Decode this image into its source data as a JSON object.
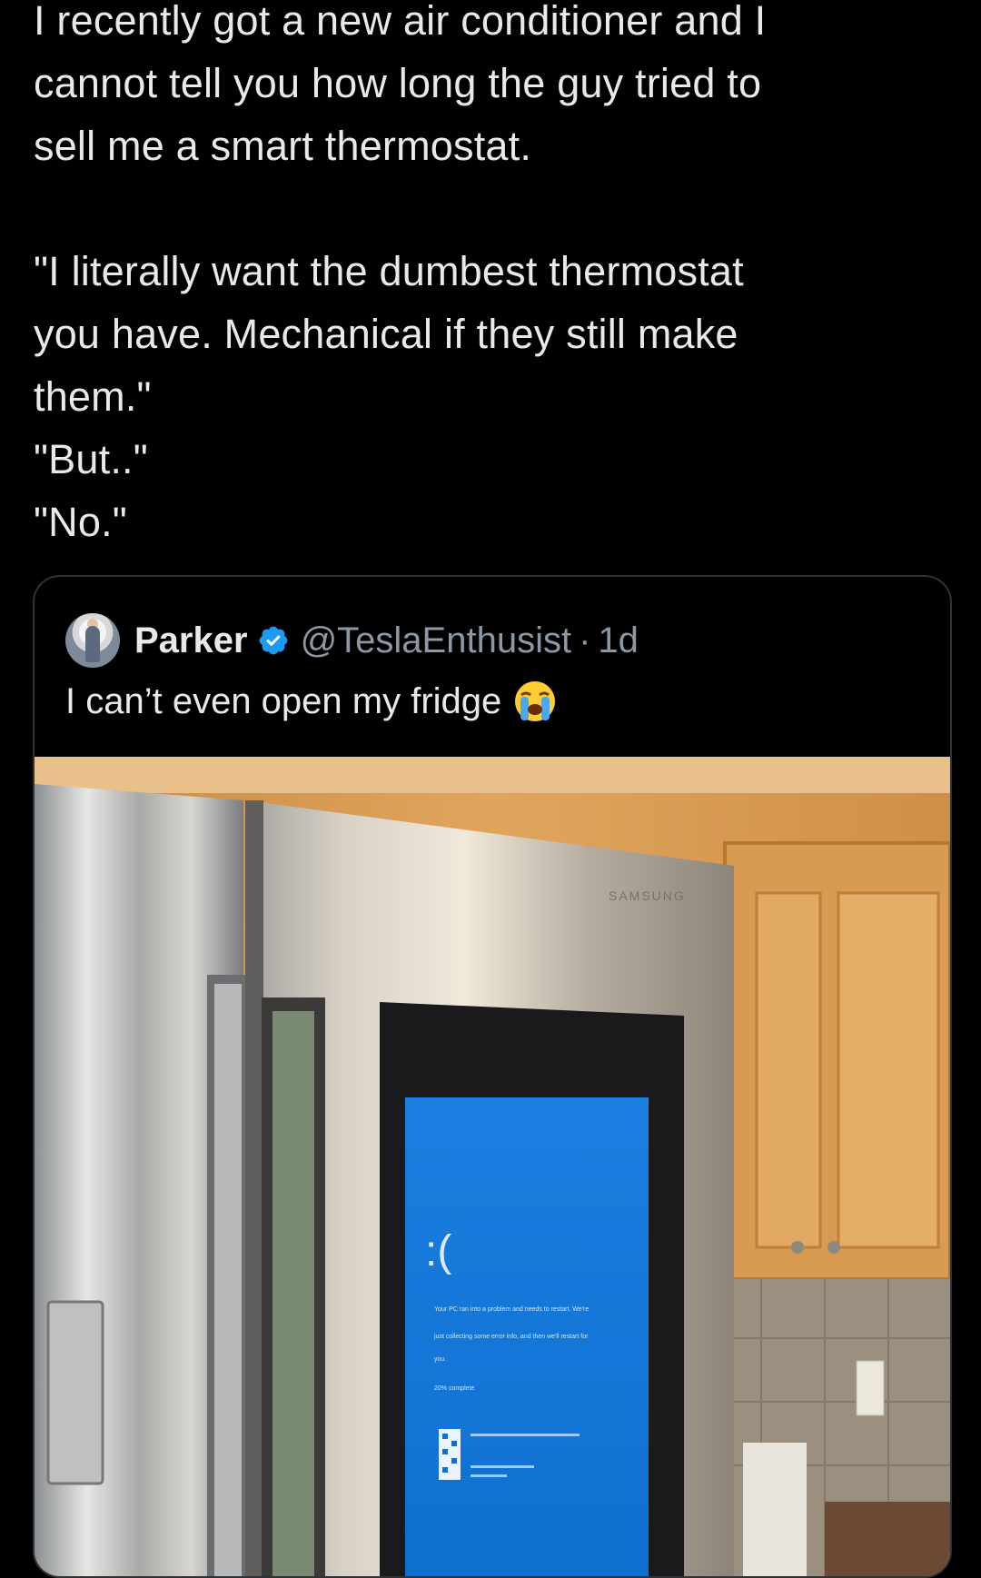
{
  "tweet": {
    "lines": [
      "I recently got a new air conditioner and I",
      "cannot tell you how long the guy tried to",
      "sell me a smart thermostat.",
      "\"I literally want the dumbest thermostat",
      "you have. Mechanical if they still make",
      "them.\"",
      "\"But..\"",
      "\"No.\""
    ]
  },
  "quote": {
    "display_name": "Parker",
    "handle": "@TeslaEnthusist",
    "separator": "·",
    "time": "1d",
    "text": "I can’t even open my fridge",
    "emoji": "loudly-crying-face"
  },
  "media": {
    "brand": "SAMSUNG",
    "screen": {
      "sad_face": ":(",
      "msg_line1": "Your PC ran into a problem and needs to restart. We're",
      "msg_line2": "just collecting some error info, and then we'll restart for",
      "msg_line3": "you.",
      "progress": "20% complete"
    }
  },
  "colors": {
    "background": "#000000",
    "text": "#e7e9ea",
    "secondary_text": "#8b98a5",
    "border": "#2f3336",
    "verified": "#1d9bf0",
    "bsod_blue": "#1478d7"
  }
}
